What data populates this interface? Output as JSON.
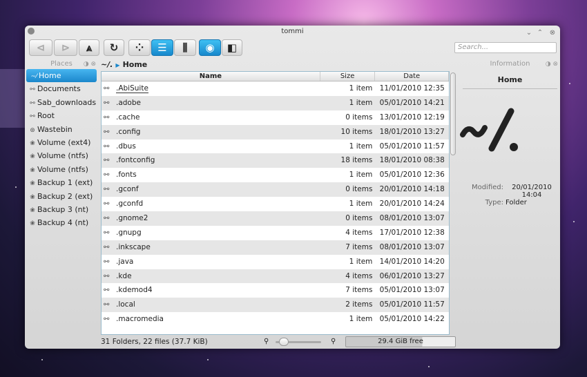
{
  "window": {
    "title": "tommi"
  },
  "toolbar": {
    "back_icon": "back-icon",
    "forward_icon": "forward-icon",
    "up_icon": "up-icon",
    "reload_icon": "reload-icon",
    "icons_view_icon": "icons-view-icon",
    "details_view_icon": "details-view-icon",
    "columns_view_icon": "columns-view-icon",
    "preview_icon": "preview-icon",
    "split_icon": "split-view-icon",
    "search_placeholder": "Search...",
    "accent_color": "#1b87cb"
  },
  "places": {
    "header": "Places",
    "items": [
      {
        "label": "Home",
        "icon": "home-icon",
        "selected": true
      },
      {
        "label": "Documents",
        "icon": "folder-icon"
      },
      {
        "label": "Sab_downloads",
        "icon": "folder-icon"
      },
      {
        "label": "Root",
        "icon": "folder-icon"
      },
      {
        "label": "Wastebin",
        "icon": "trash-icon"
      },
      {
        "label": "Volume (ext4)",
        "icon": "drive-icon"
      },
      {
        "label": "Volume (ntfs)",
        "icon": "drive-icon"
      },
      {
        "label": "Volume (ntfs)",
        "icon": "drive-icon"
      },
      {
        "label": "Backup 1 (ext)",
        "icon": "drive-icon"
      },
      {
        "label": "Backup 2 (ext)",
        "icon": "drive-icon"
      },
      {
        "label": "Backup 3 (nt)",
        "icon": "drive-icon"
      },
      {
        "label": "Backup 4 (nt)",
        "icon": "drive-icon"
      }
    ]
  },
  "breadcrumb": {
    "current": "Home",
    "root_glyph": "~/."
  },
  "files": {
    "columns": {
      "name": "Name",
      "size": "Size",
      "date": "Date"
    },
    "rows": [
      {
        "name": ".AbiSuite",
        "size": "1 item",
        "date": "11/01/2010 12:35"
      },
      {
        "name": ".adobe",
        "size": "1 item",
        "date": "05/01/2010 14:21"
      },
      {
        "name": ".cache",
        "size": "0 items",
        "date": "13/01/2010 12:19"
      },
      {
        "name": ".config",
        "size": "10 items",
        "date": "18/01/2010 13:27"
      },
      {
        "name": ".dbus",
        "size": "1 item",
        "date": "05/01/2010 11:57"
      },
      {
        "name": ".fontconfig",
        "size": "18 items",
        "date": "18/01/2010 08:38"
      },
      {
        "name": ".fonts",
        "size": "1 item",
        "date": "05/01/2010 12:36"
      },
      {
        "name": ".gconf",
        "size": "0 items",
        "date": "20/01/2010 14:18"
      },
      {
        "name": ".gconfd",
        "size": "1 item",
        "date": "20/01/2010 14:24"
      },
      {
        "name": ".gnome2",
        "size": "0 items",
        "date": "08/01/2010 13:07"
      },
      {
        "name": ".gnupg",
        "size": "4 items",
        "date": "17/01/2010 12:38"
      },
      {
        "name": ".inkscape",
        "size": "7 items",
        "date": "08/01/2010 13:07"
      },
      {
        "name": ".java",
        "size": "1 item",
        "date": "14/01/2010 14:20"
      },
      {
        "name": ".kde",
        "size": "4 items",
        "date": "06/01/2010 13:27"
      },
      {
        "name": ".kdemod4",
        "size": "7 items",
        "date": "05/01/2010 13:07"
      },
      {
        "name": ".local",
        "size": "2 items",
        "date": "05/01/2010 11:57"
      },
      {
        "name": ".macromedia",
        "size": "1 item",
        "date": "05/01/2010 14:22"
      }
    ]
  },
  "status": {
    "summary": "31 Folders, 22 files (37.7 KiB)",
    "free_space": "29.4 GiB free",
    "used_fraction": 0.7
  },
  "info": {
    "header": "Information",
    "title": "Home",
    "logo_glyph": "~/.",
    "modified_label": "Modified:",
    "modified_value": "20/01/2010 14:04",
    "type_label": "Type:",
    "type_value": "Folder"
  }
}
